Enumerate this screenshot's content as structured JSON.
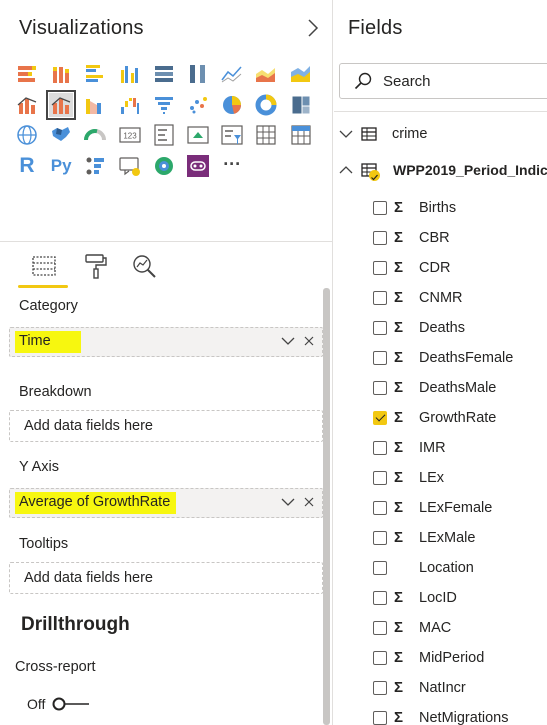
{
  "visualizations": {
    "title": "Visualizations",
    "icons": [
      "stacked-bar-chart-icon",
      "stacked-column-chart-icon",
      "clustered-bar-chart-icon",
      "clustered-column-chart-icon",
      "100-stacked-bar-chart-icon",
      "100-stacked-column-chart-icon",
      "line-chart-icon",
      "area-chart-icon",
      "stacked-area-chart-icon",
      "line-and-stacked-column-icon",
      "line-and-clustered-column-icon",
      "ribbon-chart-icon",
      "waterfall-chart-icon",
      "funnel-icon",
      "scatter-chart-icon",
      "pie-chart-icon",
      "donut-chart-icon",
      "treemap-icon",
      "map-icon",
      "filled-map-icon",
      "gauge-icon",
      "card-icon",
      "multi-row-card-icon",
      "kpi-icon",
      "slicer-icon",
      "table-icon",
      "matrix-icon",
      "r-visual-icon",
      "python-visual-icon",
      "key-influencers-icon",
      "decomposition-tree-icon",
      "qa-icon",
      "power-apps-icon",
      "more-visuals-icon"
    ],
    "selected_icon": "line-and-clustered-column-icon",
    "r_glyph": "R",
    "py_glyph": "Py",
    "more_glyph": "···",
    "wells": {
      "category": {
        "label": "Category",
        "value": "Time"
      },
      "breakdown": {
        "label": "Breakdown",
        "placeholder": "Add data fields here"
      },
      "y_axis": {
        "label": "Y Axis",
        "value": "Average of GrowthRate"
      },
      "tooltips": {
        "label": "Tooltips",
        "placeholder": "Add data fields here"
      }
    },
    "drillthrough": {
      "title": "Drillthrough",
      "cross_report_label": "Cross-report",
      "toggle_state": "Off"
    },
    "highlight_color": "#f7f70f",
    "accent_color": "#f2c811"
  },
  "fields": {
    "title": "Fields",
    "search_placeholder": "Search",
    "tables": [
      {
        "name": "crime",
        "expanded": false
      },
      {
        "name": "WPP2019_Period_Indic...",
        "expanded": true
      }
    ],
    "items": [
      {
        "name": "Births",
        "sigma": true,
        "checked": false
      },
      {
        "name": "CBR",
        "sigma": true,
        "checked": false
      },
      {
        "name": "CDR",
        "sigma": true,
        "checked": false
      },
      {
        "name": "CNMR",
        "sigma": true,
        "checked": false
      },
      {
        "name": "Deaths",
        "sigma": true,
        "checked": false
      },
      {
        "name": "DeathsFemale",
        "sigma": true,
        "checked": false
      },
      {
        "name": "DeathsMale",
        "sigma": true,
        "checked": false
      },
      {
        "name": "GrowthRate",
        "sigma": true,
        "checked": true
      },
      {
        "name": "IMR",
        "sigma": true,
        "checked": false
      },
      {
        "name": "LEx",
        "sigma": true,
        "checked": false
      },
      {
        "name": "LExFemale",
        "sigma": true,
        "checked": false
      },
      {
        "name": "LExMale",
        "sigma": true,
        "checked": false
      },
      {
        "name": "Location",
        "sigma": false,
        "checked": false
      },
      {
        "name": "LocID",
        "sigma": true,
        "checked": false
      },
      {
        "name": "MAC",
        "sigma": true,
        "checked": false
      },
      {
        "name": "MidPeriod",
        "sigma": true,
        "checked": false
      },
      {
        "name": "NatIncr",
        "sigma": true,
        "checked": false
      },
      {
        "name": "NetMigrations",
        "sigma": true,
        "checked": false
      }
    ]
  }
}
